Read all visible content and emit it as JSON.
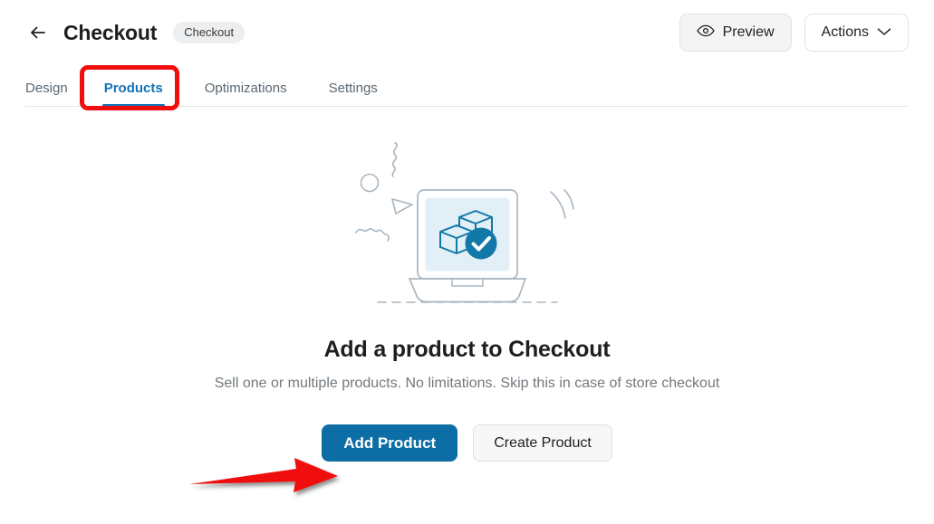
{
  "header": {
    "back_icon": "arrow-left-icon",
    "title": "Checkout",
    "badge": "Checkout",
    "preview_icon": "eye-icon",
    "preview_label": "Preview",
    "actions_label": "Actions",
    "actions_icon": "chevron-down-icon"
  },
  "tabs": [
    {
      "label": "Design",
      "active": false
    },
    {
      "label": "Products",
      "active": true
    },
    {
      "label": "Optimizations",
      "active": false
    },
    {
      "label": "Settings",
      "active": false
    }
  ],
  "empty_state": {
    "illustration": "laptop-package-check-illustration",
    "title": "Add a product to Checkout",
    "subtitle": "Sell one or multiple products. No limitations. Skip this in case of store checkout",
    "primary_button": "Add Product",
    "secondary_button": "Create Product"
  },
  "annotations": {
    "highlight_box_target": "Products",
    "arrow_target": "Add Product",
    "annotation_color": "#ef0d0d"
  },
  "colors": {
    "accent_blue": "#1172b8",
    "primary_button": "#0c6ea4",
    "illustration_blue": "#1278a8",
    "illustration_screen": "#e3eff7",
    "illustration_outline": "#a9b4c0",
    "background": "#ffffff",
    "muted_text": "#72787d"
  }
}
